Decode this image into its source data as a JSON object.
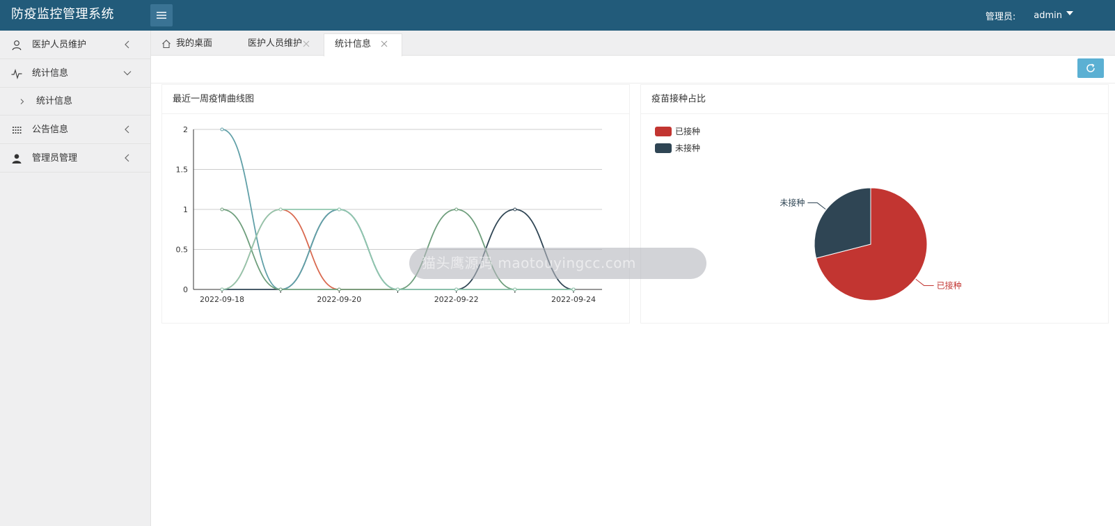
{
  "app": {
    "title": "防疫监控管理系统"
  },
  "header": {
    "role_label": "管理员:",
    "username": "admin"
  },
  "sidebar": {
    "items": [
      {
        "label": "医护人员维护"
      },
      {
        "label": "统计信息",
        "children": [
          {
            "label": "统计信息"
          }
        ]
      },
      {
        "label": "公告信息"
      },
      {
        "label": "管理员管理"
      }
    ]
  },
  "tabs": [
    {
      "label": "我的桌面"
    },
    {
      "label": "医护人员维护"
    },
    {
      "label": "统计信息",
      "active": true
    }
  ],
  "cards": {
    "line": {
      "title": "最近一周疫情曲线图"
    },
    "pie": {
      "title": "疫苗接种占比"
    }
  },
  "watermark": "猫头鹰源码 maotouyingcc.com",
  "colors": {
    "header": "#225b7a",
    "sidebar": "#efeff0",
    "refresh": "#5bb0d3"
  },
  "chart_data": [
    {
      "type": "line",
      "title": "最近一周疫情曲线图",
      "x": [
        "2022-09-18",
        "2022-09-19",
        "2022-09-20",
        "2022-09-21",
        "2022-09-22",
        "2022-09-23",
        "2022-09-24"
      ],
      "xticks_shown": [
        "2022-09-18",
        "2022-09-20",
        "2022-09-22",
        "2022-09-24"
      ],
      "ylim": [
        0,
        2
      ],
      "yticks": [
        "0",
        "0.5",
        "1",
        "1.5",
        "2"
      ],
      "grid": true,
      "smooth": true,
      "series": [
        {
          "color": "#d9694f",
          "values": [
            0,
            1,
            0,
            0,
            0,
            0,
            0
          ]
        },
        {
          "color": "#2f4554",
          "values": [
            0,
            0,
            1,
            0,
            0,
            1,
            0
          ]
        },
        {
          "color": "#61a0a8",
          "values": [
            2,
            0,
            1,
            0,
            0,
            0,
            0
          ]
        },
        {
          "color": "#6e9e7c",
          "values": [
            1,
            0,
            0,
            0,
            1,
            0,
            0
          ]
        },
        {
          "color": "#91c7ae",
          "values": [
            0,
            1,
            1,
            0,
            0,
            0,
            0
          ]
        }
      ]
    },
    {
      "type": "pie",
      "title": "疫苗接种占比",
      "legend_position": "top-left",
      "slices": [
        {
          "label": "已接种",
          "value": 71,
          "color": "#c23531"
        },
        {
          "label": "未接种",
          "value": 29,
          "color": "#2f4554"
        }
      ]
    }
  ]
}
